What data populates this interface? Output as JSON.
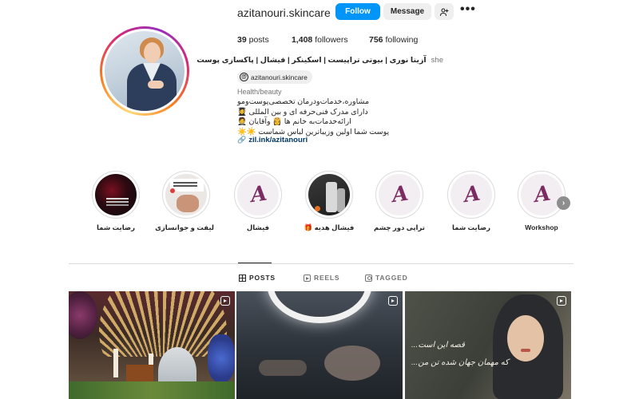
{
  "profile": {
    "username": "azitanouri.skincare",
    "follow_label": "Follow",
    "message_label": "Message",
    "more_label": "•••",
    "stats": {
      "posts": "39",
      "posts_label": "posts",
      "followers": "1,408",
      "followers_label": "followers",
      "following": "756",
      "following_label": "following"
    },
    "pronoun": "she",
    "full_name": "آزیتا نوری | بیوتی تراپیست | اسکینکر | فیشال | پاکسازی پوست",
    "threads_handle": "azitanouri.skincare",
    "threads_icon": "threads-icon",
    "category": "Health/beauty",
    "bio_lines": [
      "مشاوره،خدمات‌ودرمان تخصصی‌پوست‌ومو",
      "دارای مدرک فنی‌حرفه ای و بین المللی 👩‍🎓",
      "ارائه‌خدمات‌به خانم ها 👸 وآقایان 🤵",
      "پوست شما اولین وزیباترین لباس شماست ☀️☀️"
    ],
    "link": "zil.ink/azitanouri",
    "link_icon": "link-icon"
  },
  "highlights": [
    {
      "label": "Workshop",
      "style": "logo"
    },
    {
      "label": "رضایت شما",
      "style": "logo"
    },
    {
      "label": "تراپی دور چشم",
      "style": "logo"
    },
    {
      "label": "فیشال هدیه 🎁",
      "style": "product"
    },
    {
      "label": "فیشال",
      "style": "logo"
    },
    {
      "label": "لیفت و جوانسازی",
      "style": "card"
    },
    {
      "label": "رضایت شما",
      "style": "dark"
    }
  ],
  "highlight_logo_text": "A",
  "tabs": [
    {
      "label": "POSTS",
      "icon": "grid-icon",
      "active": true
    },
    {
      "label": "REELS",
      "icon": "reels-icon",
      "active": false
    },
    {
      "label": "TAGGED",
      "icon": "tagged-icon",
      "active": false
    }
  ],
  "posts": [
    {
      "type": "reel",
      "icon": "reel-icon"
    },
    {
      "type": "reel",
      "icon": "reel-icon"
    },
    {
      "type": "reel",
      "icon": "reel-icon",
      "overlay_line1": "قصه این است...",
      "overlay_line2": "که مهمان جهان شده تن من..."
    }
  ],
  "colors": {
    "follow_button": "#0095f6",
    "link": "#00376b",
    "secondary_text": "#737373"
  }
}
